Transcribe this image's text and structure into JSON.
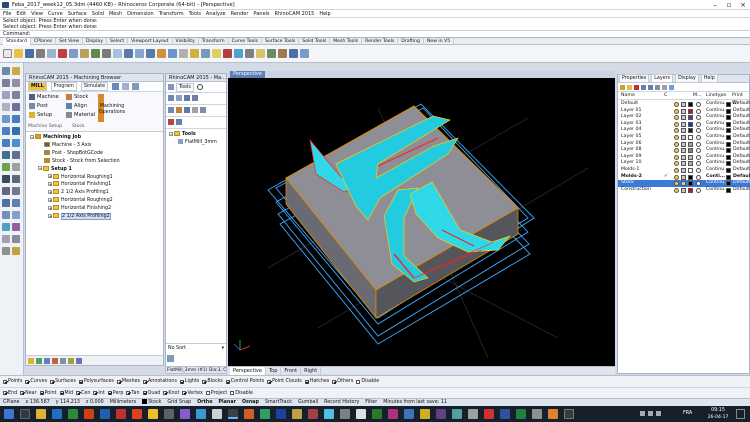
{
  "window": {
    "title": "Feba_2017_week12_05.3dm (4460 KB) - Rhinoceros Corporate (64-bit) - [Perspective]"
  },
  "menu": [
    "File",
    "Edit",
    "View",
    "Curve",
    "Surface",
    "Solid",
    "Mesh",
    "Dimension",
    "Transform",
    "Tools",
    "Analyze",
    "Render",
    "Panels",
    "RhinoCAM 2015",
    "Help"
  ],
  "history": [
    "Select object. Press Enter when done:",
    "Select object. Press Enter when done:"
  ],
  "command": {
    "label": "Command:"
  },
  "toolbar_tabs": [
    "Standard",
    "CPlanes",
    "Set View",
    "Display",
    "Select",
    "Viewport Layout",
    "Visibility",
    "Transform",
    "Curve Tools",
    "Surface Tools",
    "Solid Tools",
    "Mesh Tools",
    "Render Tools",
    "Drafting",
    "New in V5"
  ],
  "browser": {
    "title": "RhinoCAM 2015 - Machining Browser",
    "mill": "MILL",
    "tabs": [
      "Program",
      "Simulate"
    ],
    "buttons": {
      "machine": "Machine",
      "post": "Post",
      "setup": "Setup",
      "stock": "Stock",
      "align": "Align",
      "material": "Material",
      "mops": "Machining Operations"
    },
    "groups": [
      "Machine Setup",
      "Stock"
    ],
    "tree": {
      "root": "Machining Job",
      "machine": "Machine - 3 Axis",
      "post": "Post - ShopBotGCode",
      "stock": "Stock - Stock from Selection",
      "setup": "Setup 1",
      "ops": [
        "Horizontal Roughing1",
        "Horizontal Finishing1",
        "2 1/2 Axis Profiling1",
        "Horizontal Roughing2",
        "Horizontal Finishing2",
        "2 1/2 Axis Profiling2"
      ]
    }
  },
  "tools_panel": {
    "title": "RhinoCAM 2015 - Ma...",
    "tab": "Tools",
    "root": "Tools",
    "item": "FlatMill_3mm",
    "sort": "No Sort",
    "footer": "FlatMill_3mm (#1) Dia:3, Cl:"
  },
  "viewport": {
    "name": "Perspective",
    "tabs": [
      "Perspective",
      "Top",
      "Front",
      "Right"
    ]
  },
  "layers_panel": {
    "tabs": [
      "Properties",
      "Layers",
      "Display",
      "Help"
    ],
    "col_name": "Name",
    "col_c": "C",
    "col_m": "M...",
    "col_linetype": "Linetype",
    "col_print": "Print Wi",
    "rows": [
      {
        "name": "Default",
        "c": "#000000",
        "lt": "Continu...",
        "pw": "Default",
        "sel": false,
        "bold": false
      },
      {
        "name": "Layer 01",
        "c": "#d01010",
        "lt": "Continu...",
        "pw": "Default",
        "sel": false,
        "bold": false
      },
      {
        "name": "Layer 02",
        "c": "#6030a0",
        "lt": "Continu...",
        "pw": "Default",
        "sel": false,
        "bold": false
      },
      {
        "name": "Layer 03",
        "c": "#1030d0",
        "lt": "Continu...",
        "pw": "Default",
        "sel": false,
        "bold": false
      },
      {
        "name": "Layer 04",
        "c": "#202020",
        "lt": "Continu...",
        "pw": "Default",
        "sel": false,
        "bold": false
      },
      {
        "name": "Layer 05",
        "c": "#ffffff",
        "lt": "Continu...",
        "pw": "Default",
        "sel": false,
        "bold": false
      },
      {
        "name": "Layer 06",
        "c": "#a0a0a0",
        "lt": "Continu...",
        "pw": "Default",
        "sel": false,
        "bold": false
      },
      {
        "name": "Layer 08",
        "c": "#808080",
        "lt": "Continu...",
        "pw": "Default",
        "sel": false,
        "bold": false
      },
      {
        "name": "Layer 09",
        "c": "#c0c0c0",
        "lt": "Continu...",
        "pw": "Default",
        "sel": false,
        "bold": false
      },
      {
        "name": "Layer 10",
        "c": "#d0a0a0",
        "lt": "Continu...",
        "pw": "Default",
        "sel": false,
        "bold": false
      },
      {
        "name": "Molds-1",
        "c": "#ffffff",
        "lt": "Continu...",
        "pw": "Default",
        "sel": false,
        "bold": false
      },
      {
        "name": "Molds-2",
        "c": "#000000",
        "lt": "Conti...",
        "pw": "Default",
        "sel": false,
        "bold": true
      },
      {
        "name": "Stock",
        "c": "#000000",
        "lt": "Continu...",
        "pw": "Default",
        "sel": true,
        "bold": false
      },
      {
        "name": "Construction",
        "c": "#d01010",
        "lt": "Continu...",
        "pw": "Default",
        "sel": false,
        "bold": false
      }
    ]
  },
  "osnap1": [
    {
      "l": "Points",
      "on": true
    },
    {
      "l": "Curves",
      "on": true
    },
    {
      "l": "Surfaces",
      "on": true
    },
    {
      "l": "Polysurfaces",
      "on": true
    },
    {
      "l": "Meshes",
      "on": true
    },
    {
      "l": "Annotations",
      "on": true
    },
    {
      "l": "Lights",
      "on": true
    },
    {
      "l": "Blocks",
      "on": true
    },
    {
      "l": "Control Points",
      "on": true
    },
    {
      "l": "Point Clouds",
      "on": true
    },
    {
      "l": "Hatches",
      "on": true
    },
    {
      "l": "Others",
      "on": true
    },
    {
      "l": "Disable",
      "on": false
    }
  ],
  "osnap2": [
    {
      "l": "End",
      "on": true
    },
    {
      "l": "Near",
      "on": true
    },
    {
      "l": "Point",
      "on": true
    },
    {
      "l": "Mid",
      "on": true
    },
    {
      "l": "Cen",
      "on": true
    },
    {
      "l": "Int",
      "on": true
    },
    {
      "l": "Perp",
      "on": true
    },
    {
      "l": "Tan",
      "on": true
    },
    {
      "l": "Quad",
      "on": true
    },
    {
      "l": "Knot",
      "on": true
    },
    {
      "l": "Vertex",
      "on": true
    },
    {
      "l": "Project",
      "on": false
    },
    {
      "l": "Disable",
      "on": false
    }
  ],
  "status": {
    "cplane": "CPlane",
    "x": "x 136.587",
    "y": "y 114.213",
    "z": "z 0.000",
    "units": "Millimeters",
    "layer": "Stock",
    "grid": "Grid Snap",
    "ortho": "Ortho",
    "planar": "Planar",
    "osnap": "Osnap",
    "smarttrack": "SmartTrack",
    "gumball": "Gumball",
    "record": "Record History",
    "filter": "Filter",
    "save": "Minutes from last save: 11"
  },
  "clock": {
    "time": "09:15",
    "date": "26-04-17",
    "lang": "FRA"
  }
}
